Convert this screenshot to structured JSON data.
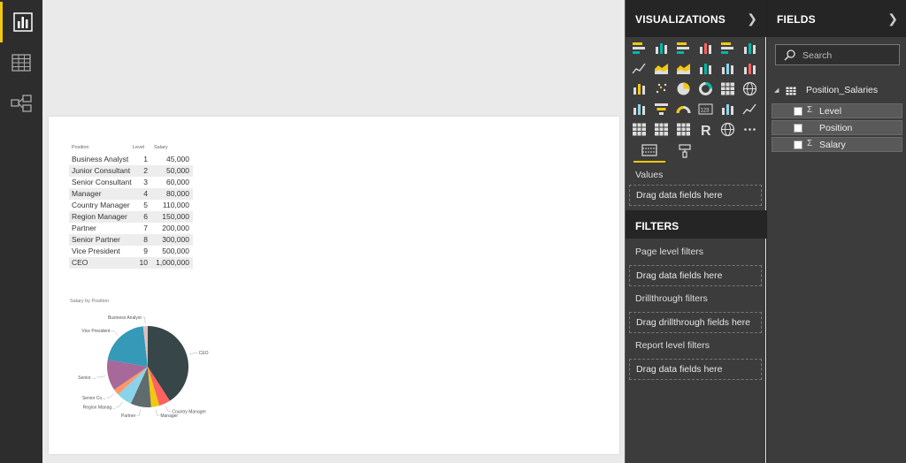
{
  "visualizations": {
    "title": "VISUALIZATIONS",
    "values_label": "Values",
    "values_drop": "Drag data fields here"
  },
  "filters": {
    "title": "FILTERS",
    "page_label": "Page level filters",
    "page_drop": "Drag data fields here",
    "drill_label": "Drillthrough filters",
    "drill_drop": "Drag drillthrough fields here",
    "report_label": "Report level filters",
    "report_drop": "Drag data fields here"
  },
  "fields_pane": {
    "title": "FIELDS",
    "search_placeholder": "Search",
    "table_name": "Position_Salaries",
    "fields": [
      {
        "name": "Level",
        "aggregate": "Σ"
      },
      {
        "name": "Position",
        "aggregate": ""
      },
      {
        "name": "Salary",
        "aggregate": "Σ"
      }
    ]
  },
  "table_visual": {
    "headers": [
      "Position",
      "Level",
      "Salary"
    ],
    "rows": [
      [
        "Business Analyst",
        "1",
        "45,000"
      ],
      [
        "Junior Consultant",
        "2",
        "50,000"
      ],
      [
        "Senior Consultant",
        "3",
        "60,000"
      ],
      [
        "Manager",
        "4",
        "80,000"
      ],
      [
        "Country Manager",
        "5",
        "110,000"
      ],
      [
        "Region Manager",
        "6",
        "150,000"
      ],
      [
        "Partner",
        "7",
        "200,000"
      ],
      [
        "Senior Partner",
        "8",
        "300,000"
      ],
      [
        "Vice President",
        "9",
        "500,000"
      ],
      [
        "CEO",
        "10",
        "1,000,000"
      ]
    ]
  },
  "chart_data": {
    "type": "pie",
    "title": "Salary by Position",
    "categories": [
      "CEO",
      "Country Manager",
      "Manager",
      "Partner",
      "Region Manag...",
      "Senior Co...",
      "Senior ...",
      "Vice President",
      "Business Analyst"
    ],
    "values": [
      1000000,
      110000,
      80000,
      200000,
      150000,
      60000,
      300000,
      500000,
      45000
    ],
    "colors": [
      "#374649",
      "#fd625e",
      "#f2c80f",
      "#5f6b6d",
      "#8ad4eb",
      "#fe9666",
      "#a66999",
      "#3599b8",
      "#dfbfbf",
      "#01b8aa"
    ],
    "legend": "none"
  }
}
